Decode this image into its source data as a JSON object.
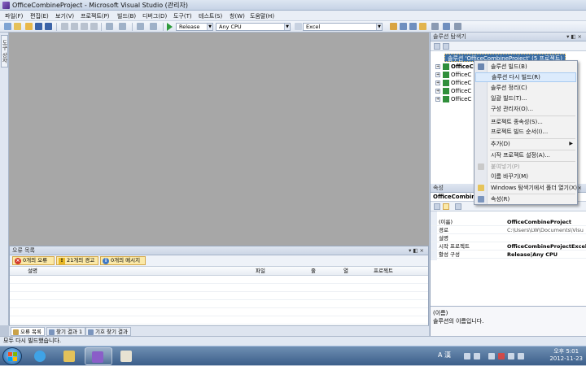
{
  "window": {
    "title": "OfficeCombineProject - Microsoft Visual Studio (관리자)"
  },
  "menu": [
    "파일(F)",
    "편집(E)",
    "보기(V)",
    "프로젝트(P)",
    "빌드(B)",
    "디버그(D)",
    "도구(T)",
    "테스트(S)",
    "창(W)",
    "도움말(H)"
  ],
  "toolbar": {
    "config": "Release",
    "platform": "Any CPU",
    "find": "Excel"
  },
  "toolbox_tab": "도구 상자",
  "error_list": {
    "title": "오류 목록",
    "errors_btn": "0개의 오류",
    "warnings_btn": "21개의 경고",
    "messages_btn": "0개의 메시지",
    "columns": [
      "설명",
      "파일",
      "줄",
      "열",
      "프로젝트"
    ]
  },
  "bottom_tabs": [
    "오류 목록",
    "찾기 결과 1",
    "기호 찾기 결과"
  ],
  "solution_explorer": {
    "title": "솔루션 탐색기",
    "root": "솔루션 'OfficeCombineProject' (5 프로젝트)",
    "projects": [
      "OfficeC",
      "OfficeC",
      "OfficeC",
      "OfficeC",
      "OfficeC"
    ]
  },
  "context_menu": [
    {
      "label": "솔루션 빌드(B)",
      "icon": "build-icon"
    },
    {
      "label": "솔루션 다시 빌드(R)",
      "highlight": true
    },
    {
      "label": "솔루션 정리(C)"
    },
    {
      "label": "일괄 빌드(T)..."
    },
    {
      "label": "구성 관리자(O)..."
    },
    {
      "sep": true
    },
    {
      "label": "프로젝트 종속성(S)..."
    },
    {
      "label": "프로젝트 빌드 순서(I)..."
    },
    {
      "sep": true
    },
    {
      "label": "추가(D)",
      "submenu": true
    },
    {
      "sep": true
    },
    {
      "label": "시작 프로젝트 설정(A)..."
    },
    {
      "sep": true
    },
    {
      "label": "붙여넣기(P)",
      "disabled": true,
      "icon": "paste-icon"
    },
    {
      "label": "이름 바꾸기(M)"
    },
    {
      "sep": true
    },
    {
      "label": "Windows 탐색기에서 폴더 열기(X)",
      "icon": "folder-icon"
    },
    {
      "sep": true
    },
    {
      "label": "속성(R)",
      "icon": "properties-icon"
    }
  ],
  "properties": {
    "title": "속성",
    "object": "OfficeCombineProject",
    "rows": [
      {
        "name": "(이름)",
        "value": "OfficeCombineProject",
        "bold": true
      },
      {
        "name": "경로",
        "value": "C:\\Users\\LW\\Documents\\Visu",
        "bold": false
      },
      {
        "name": "설명",
        "value": "",
        "bold": false
      },
      {
        "name": "시작 프로젝트",
        "value": "OfficeCombineProjectExcel2007",
        "bold": true
      },
      {
        "name": "활성 구성",
        "value": "Release|Any CPU",
        "bold": true
      }
    ],
    "desc_title": "(이름)",
    "desc_text": "솔루션의 이름입니다."
  },
  "status": "모두 다시 빌드했습니다.",
  "taskbar": {
    "ime": "A 漢",
    "time": "오후 5:01",
    "date": "2012-11-23"
  }
}
